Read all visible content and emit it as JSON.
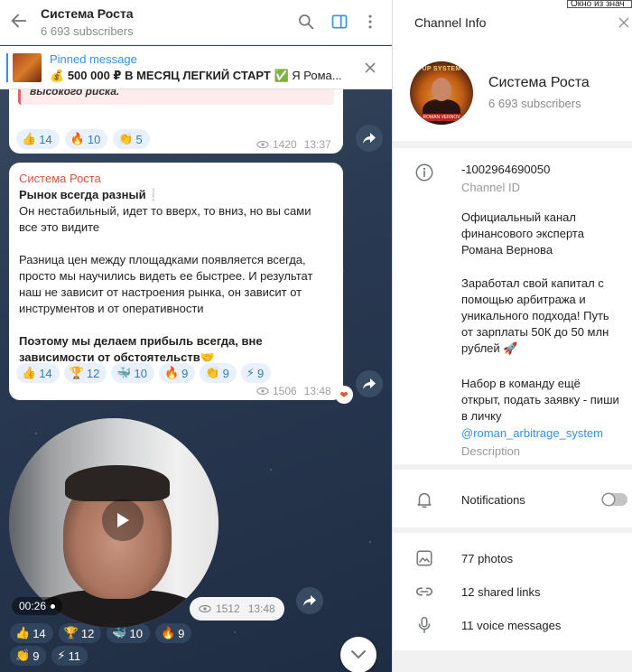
{
  "chat": {
    "title": "Система Роста",
    "subscribers": "6 693 subscribers",
    "pinned": {
      "label": "Pinned message",
      "icon_emoji": "💰",
      "text_bold": "500 000 ₽ В МЕСЯЦ ЛЕГКИЙ СТАРТ",
      "check_emoji": "✅",
      "text_rest": "Я Рома..."
    }
  },
  "messages": [
    {
      "quote": "высокого риска.",
      "reactions": [
        {
          "emoji": "👍",
          "count": "14"
        },
        {
          "emoji": "🔥",
          "count": "10"
        },
        {
          "emoji": "👏",
          "count": "5"
        }
      ],
      "views": "1420",
      "time": "13:37"
    },
    {
      "author": "Система Роста",
      "title": "Рынок всегда разный❕",
      "p1": "Он нестабильный, идет то вверх, то вниз, но вы сами все это видите",
      "p2": "Разница цен между площадками появляется всегда, просто мы научились видеть ее быстрее. И результат наш не зависит от настроения рынка, он зависит от инструментов и от оперативности",
      "p3": "Поэтому мы делаем прибыль всегда, вне зависимости от обстоятельств🤝",
      "reactions": [
        {
          "emoji": "👍",
          "count": "14"
        },
        {
          "emoji": "🏆",
          "count": "12"
        },
        {
          "emoji": "🐳",
          "count": "10"
        },
        {
          "emoji": "🔥",
          "count": "9"
        },
        {
          "emoji": "👏",
          "count": "9"
        },
        {
          "emoji": "⚡",
          "count": "9"
        }
      ],
      "views": "1506",
      "time": "13:48",
      "my_reaction": "❤"
    },
    {
      "duration": "00:26",
      "views": "1512",
      "time": "13:48",
      "reactions_row1": [
        {
          "emoji": "👍",
          "count": "14"
        },
        {
          "emoji": "🏆",
          "count": "12"
        },
        {
          "emoji": "🐳",
          "count": "10"
        },
        {
          "emoji": "🔥",
          "count": "9"
        }
      ],
      "reactions_row2": [
        {
          "emoji": "👏",
          "count": "9"
        },
        {
          "emoji": "⚡",
          "count": "11"
        }
      ]
    }
  ],
  "info": {
    "header": "Channel Info",
    "corner_tag": "Окно из знач",
    "avatar_title": "UP SYSTEM",
    "avatar_name": "ROMAN VERNOV",
    "name": "Система Роста",
    "subscribers": "6 693 subscribers",
    "channel_id": "-1002964690050",
    "channel_id_label": "Channel ID",
    "desc1": "Официальный канал финансового эксперта Романа Вернова",
    "desc2": "Заработал свой капитал с помощью арбитража и уникального подхода! Путь от зарплаты 50К до 50 млн рублей 🚀",
    "desc3": "Набор в команду ещё открыт, подать заявку - пиши в личку",
    "desc_link": "@roman_arbitrage_system",
    "desc_label": "Description",
    "notifications": "Notifications",
    "photos": "77 photos",
    "links": "12 shared links",
    "voice": "11 voice messages"
  }
}
